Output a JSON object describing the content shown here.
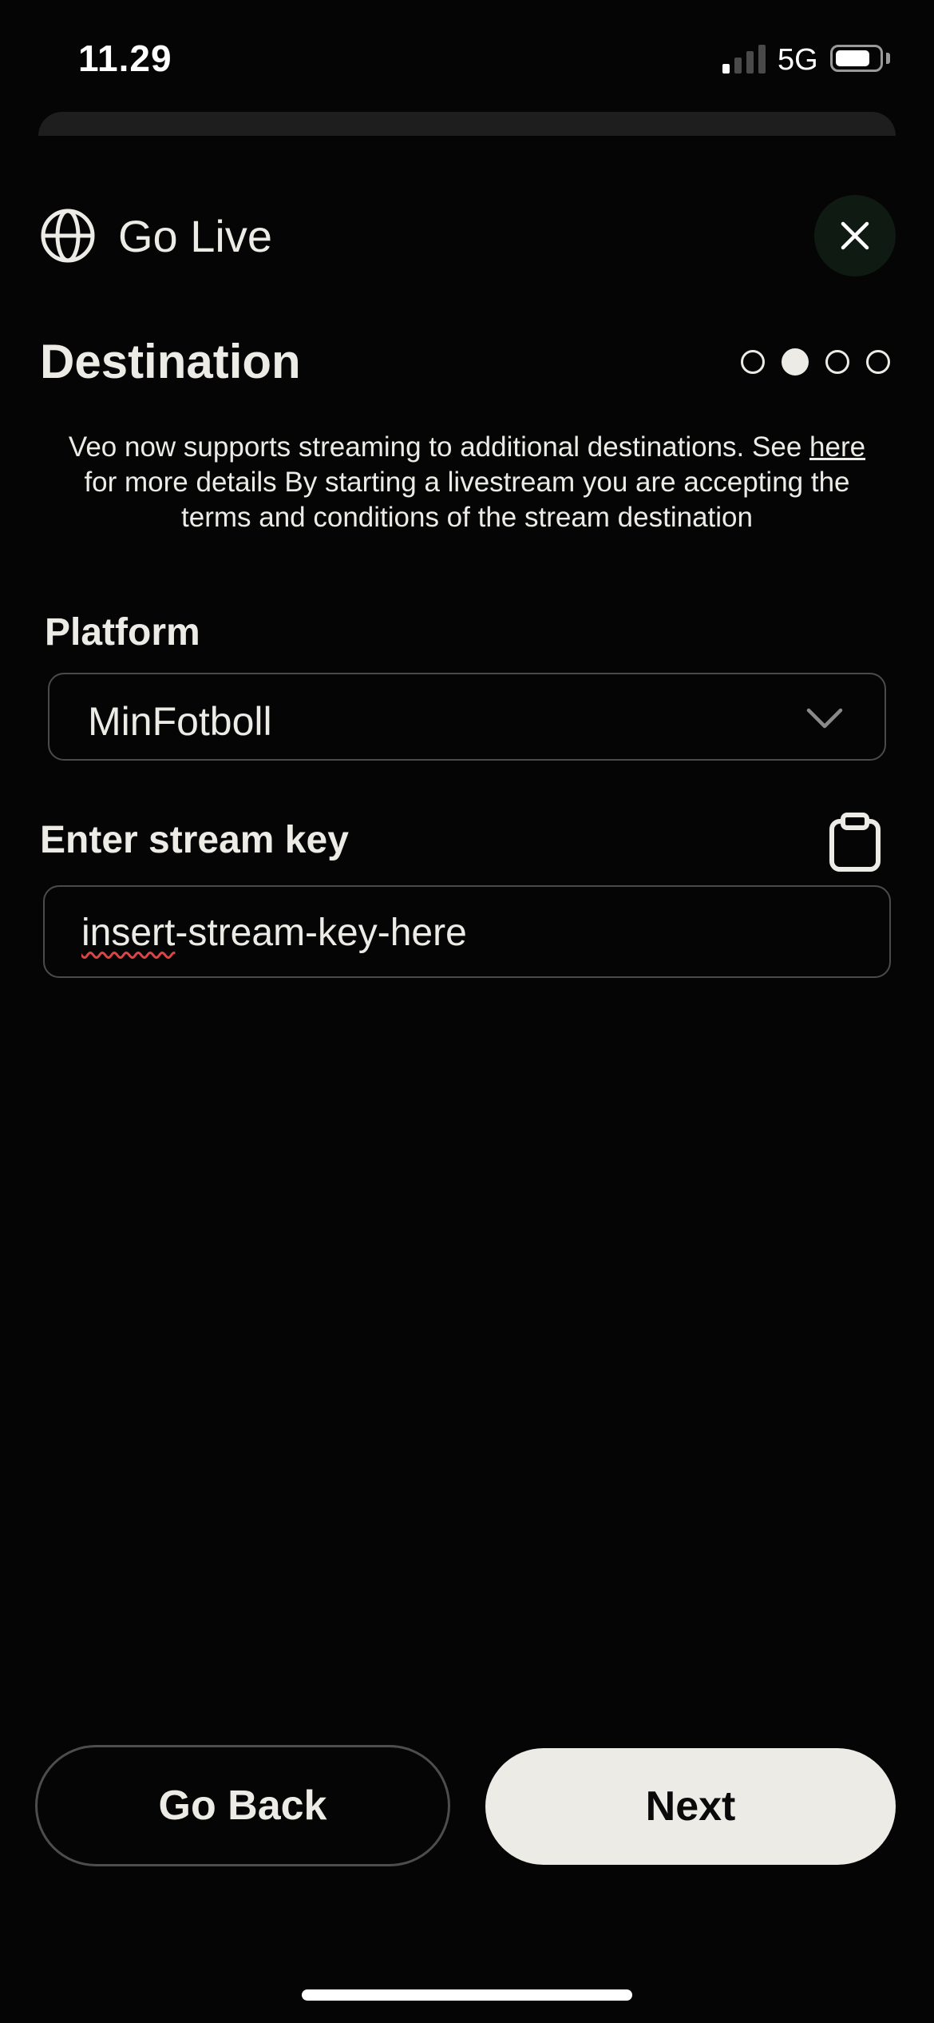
{
  "status_bar": {
    "time": "11.29",
    "network": "5G",
    "signal_bars_active": 1,
    "signal_bars_total": 4,
    "battery_level": 0.8
  },
  "header": {
    "icon": "globe-icon",
    "title": "Go Live",
    "close_icon": "close-icon"
  },
  "step": {
    "title": "Destination",
    "total_steps": 4,
    "current_step": 2
  },
  "info": {
    "text_before_link": "Veo now supports streaming to additional destinations. See ",
    "link_text": "here",
    "text_after_link": " for more details By starting a livestream you are accepting the terms and conditions of the stream destination"
  },
  "platform": {
    "label": "Platform",
    "selected_value": "MinFotboll",
    "dropdown_icon": "chevron-down-icon"
  },
  "stream_key": {
    "label": "Enter stream key",
    "paste_icon": "clipboard-icon",
    "value_misspelled_part": "insert",
    "value_rest": "-stream-key-here"
  },
  "footer": {
    "back_label": "Go Back",
    "next_label": "Next"
  },
  "colors": {
    "background": "#050505",
    "text": "#ECEBE6",
    "primary_button": "#ECEBE6",
    "border": "#4b4b4b"
  }
}
